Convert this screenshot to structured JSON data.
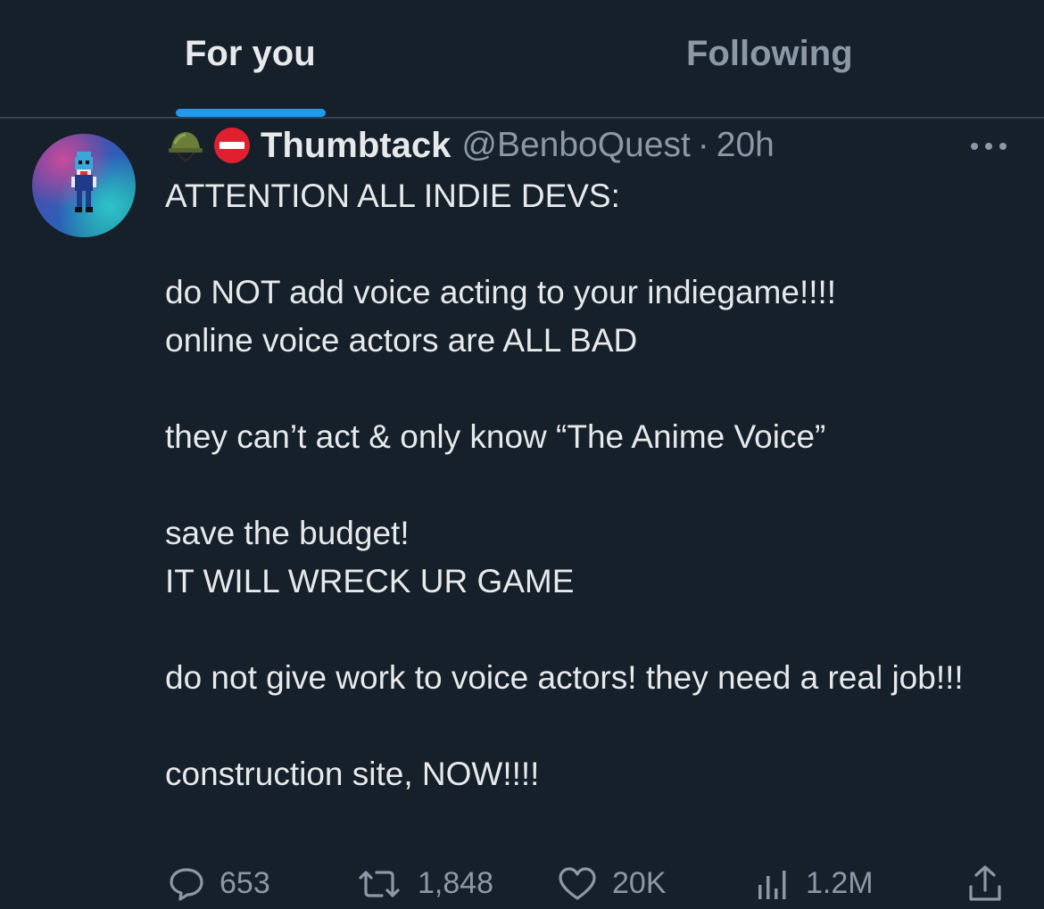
{
  "tabs": [
    {
      "label": "For you",
      "active": true
    },
    {
      "label": "Following",
      "active": false
    }
  ],
  "colors": {
    "background": "#15202b",
    "accent": "#1d9bf0",
    "text_primary": "#e7e9ea",
    "text_secondary": "#8b98a5"
  },
  "tweet": {
    "name_emojis": [
      "military-helmet-icon",
      "no-entry-icon"
    ],
    "display_name": "Thumbtack",
    "handle": "@BenboQuest",
    "separator": "·",
    "time": "20h",
    "lines": [
      "ATTENTION ALL INDIE DEVS:",
      "",
      "do NOT add voice acting to your indiegame!!!!",
      "online voice actors are ALL BAD",
      "",
      "they can’t act & only know “The Anime Voice”",
      "",
      "save the budget!",
      "IT WILL WRECK UR GAME",
      "",
      "do not give work to voice actors! they need a real job!!!",
      "",
      "construction site, NOW!!!!"
    ],
    "stats": {
      "replies": "653",
      "reposts": "1,848",
      "likes": "20K",
      "views": "1.2M"
    }
  }
}
